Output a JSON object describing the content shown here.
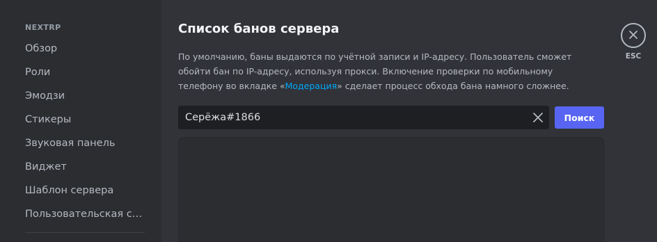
{
  "sidebar": {
    "server_name": "NEXTRP",
    "items": [
      {
        "label": "Обзор"
      },
      {
        "label": "Роли"
      },
      {
        "label": "Эмодзи"
      },
      {
        "label": "Стикеры"
      },
      {
        "label": "Звуковая панель"
      },
      {
        "label": "Виджет"
      },
      {
        "label": "Шаблон сервера"
      },
      {
        "label": "Пользовательская сс..."
      }
    ]
  },
  "main": {
    "title": "Список банов сервера",
    "description": {
      "part1": "По умолчанию, баны выдаются по учётной записи и IP-адресу. Пользователь сможет обойти бан по IP-адресу, используя прокси. Включение проверки по мобильному телефону во вкладке «",
      "link": "Модерация",
      "part2": "» сделает процесс обхода бана намного сложнее."
    },
    "search": {
      "value": "Серёжа#1866",
      "button_label": "Поиск"
    }
  },
  "close": {
    "label": "ESC"
  },
  "colors": {
    "accent": "#5865f2",
    "link": "#00a8fc",
    "background": "#313338",
    "sidebar": "#2b2d31"
  }
}
